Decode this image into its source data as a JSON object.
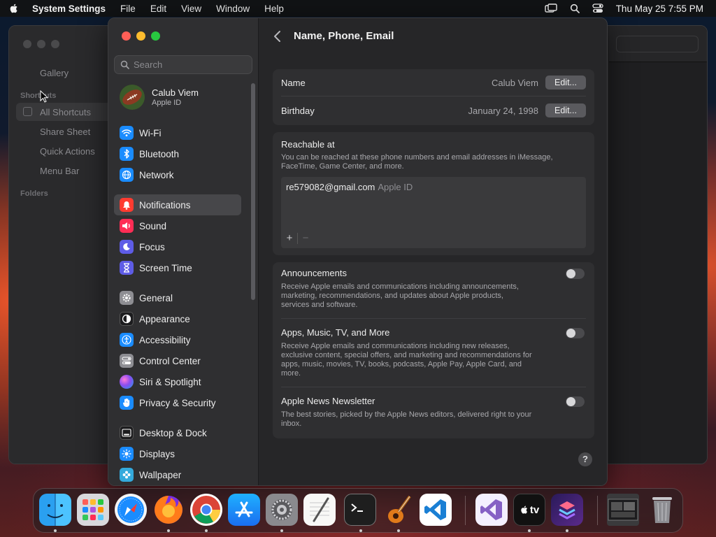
{
  "menubar": {
    "app_name": "System Settings",
    "menus": [
      "File",
      "Edit",
      "View",
      "Window",
      "Help"
    ],
    "clock": "Thu May 25  7:55 PM"
  },
  "shortcuts_window": {
    "gallery": "Gallery",
    "shortcuts_header": "Shortcuts",
    "items": [
      "All Shortcuts",
      "Share Sheet",
      "Quick Actions",
      "Menu Bar"
    ],
    "folders_header": "Folders"
  },
  "sidebar": {
    "search_placeholder": "Search",
    "account": {
      "name": "Calub Viem",
      "subtitle": "Apple ID"
    },
    "groups": [
      [
        {
          "label": "Wi-Fi",
          "icon": "wifi-icon",
          "color": "#1a8cff"
        },
        {
          "label": "Bluetooth",
          "icon": "bluetooth-icon",
          "color": "#1a8cff"
        },
        {
          "label": "Network",
          "icon": "globe-icon",
          "color": "#1a8cff"
        }
      ],
      [
        {
          "label": "Notifications",
          "icon": "bell-icon",
          "color": "#ff3b30",
          "selected": true
        },
        {
          "label": "Sound",
          "icon": "speaker-icon",
          "color": "#ff2d55"
        },
        {
          "label": "Focus",
          "icon": "moon-icon",
          "color": "#5e5ce6"
        },
        {
          "label": "Screen Time",
          "icon": "hourglass-icon",
          "color": "#5e5ce6"
        }
      ],
      [
        {
          "label": "General",
          "icon": "gear-icon",
          "color": "#8e8e93"
        },
        {
          "label": "Appearance",
          "icon": "appearance-icon",
          "color": "#1c1c1e"
        },
        {
          "label": "Accessibility",
          "icon": "accessibility-icon",
          "color": "#1a8cff"
        },
        {
          "label": "Control Center",
          "icon": "toggles-icon",
          "color": "#8e8e93"
        },
        {
          "label": "Siri & Spotlight",
          "icon": "siri-icon",
          "color": "#b04ad8"
        },
        {
          "label": "Privacy & Security",
          "icon": "hand-icon",
          "color": "#1a8cff"
        }
      ],
      [
        {
          "label": "Desktop & Dock",
          "icon": "dock-icon",
          "color": "#1c1c1e"
        },
        {
          "label": "Displays",
          "icon": "sun-icon",
          "color": "#1a8cff"
        },
        {
          "label": "Wallpaper",
          "icon": "flower-icon",
          "color": "#34aadc"
        }
      ]
    ]
  },
  "content": {
    "title": "Name, Phone, Email",
    "name_label": "Name",
    "name_value": "Calub Viem",
    "birthday_label": "Birthday",
    "birthday_value": "January 24, 1998",
    "edit_label": "Edit...",
    "reachable": {
      "title": "Reachable at",
      "description": "You can be reached at these phone numbers and email addresses in iMessage, FaceTime, Game Center, and more.",
      "email": "re579082@gmail.com",
      "email_tag": "Apple ID",
      "add": "+",
      "remove": "−"
    },
    "prefs": [
      {
        "title": "Announcements",
        "desc": "Receive Apple emails and communications including announcements, marketing, recommendations, and updates about Apple products, services and software.",
        "on": false
      },
      {
        "title": "Apps, Music, TV, and More",
        "desc": "Receive Apple emails and communications including new releases, exclusive content, special offers, and marketing and recommendations for apps, music, movies, TV, books, podcasts, Apple Pay, Apple Card, and more.",
        "on": false
      },
      {
        "title": "Apple News Newsletter",
        "desc": "The best stories, picked by the Apple News editors, delivered right to your inbox.",
        "on": false
      }
    ],
    "help": "?"
  },
  "dock": {
    "apps": [
      "finder",
      "launchpad",
      "safari",
      "firefox",
      "chrome",
      "app-store",
      "system-settings",
      "textedit",
      "terminal",
      "garageband",
      "vscode",
      "visual-studio",
      "apple-tv",
      "shortcuts",
      "downloads",
      "trash"
    ],
    "apple_tv_label": "tv"
  }
}
